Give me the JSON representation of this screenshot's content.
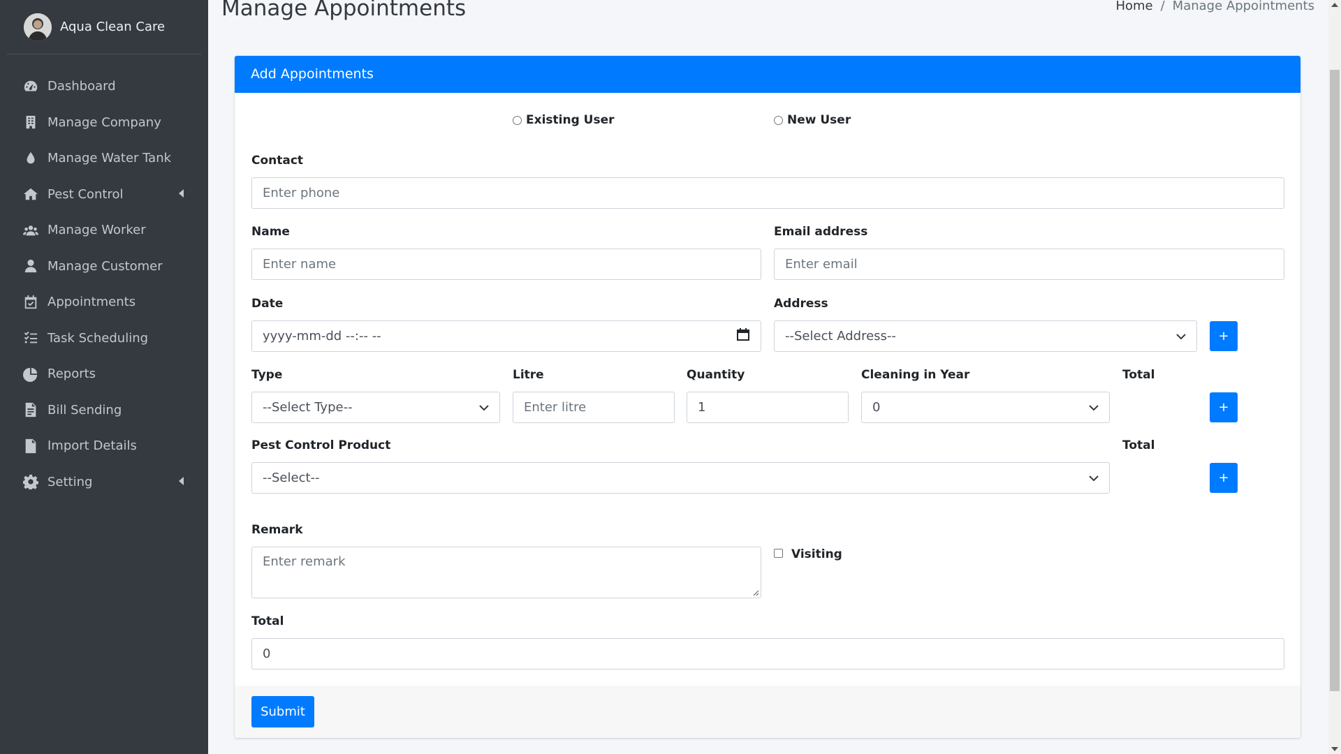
{
  "brand": {
    "name": "Aqua Clean Care"
  },
  "sidebar": {
    "items": [
      {
        "label": "Dashboard",
        "icon": "dashboard-icon"
      },
      {
        "label": "Manage Company",
        "icon": "building-icon"
      },
      {
        "label": "Manage Water Tank",
        "icon": "water-drop-icon"
      },
      {
        "label": "Pest Control",
        "icon": "home-icon",
        "has_arrow": true
      },
      {
        "label": "Manage Worker",
        "icon": "users-icon"
      },
      {
        "label": "Manage Customer",
        "icon": "user-icon"
      },
      {
        "label": "Appointments",
        "icon": "calendar-check-icon"
      },
      {
        "label": "Task Scheduling",
        "icon": "tasks-icon"
      },
      {
        "label": "Reports",
        "icon": "pie-chart-icon"
      },
      {
        "label": "Bill Sending",
        "icon": "file-invoice-icon"
      },
      {
        "label": "Import Details",
        "icon": "file-csv-icon"
      },
      {
        "label": "Setting",
        "icon": "gear-icon",
        "has_arrow": true
      }
    ]
  },
  "header": {
    "title": "Manage Appointments",
    "breadcrumb": {
      "home": "Home",
      "separator": "/",
      "current": "Manage Appointments"
    }
  },
  "card": {
    "title": "Add Appointments",
    "accent_color": "#007bff"
  },
  "form": {
    "user_type": {
      "existing": "Existing User",
      "new": "New User"
    },
    "contact": {
      "label": "Contact",
      "placeholder": "Enter phone"
    },
    "name": {
      "label": "Name",
      "placeholder": "Enter name"
    },
    "email": {
      "label": "Email address",
      "placeholder": "Enter email"
    },
    "date": {
      "label": "Date",
      "placeholder": "yyyy-mm-dd --:-- --"
    },
    "address": {
      "label": "Address",
      "selected": "--Select Address--",
      "add": "+"
    },
    "type": {
      "label": "Type",
      "selected": "--Select Type--"
    },
    "litre": {
      "label": "Litre",
      "placeholder": "Enter litre"
    },
    "quantity": {
      "label": "Quantity",
      "value": "1"
    },
    "cleaning": {
      "label": "Cleaning in Year",
      "selected": "0"
    },
    "type_total": {
      "label": "Total",
      "add": "+"
    },
    "pest_product": {
      "label": "Pest Control Product",
      "selected": "--Select--"
    },
    "pest_total": {
      "label": "Total",
      "add": "+"
    },
    "remark": {
      "label": "Remark",
      "placeholder": "Enter remark"
    },
    "visiting": {
      "label": "Visiting"
    },
    "total": {
      "label": "Total",
      "value": "0"
    },
    "submit": "Submit"
  }
}
